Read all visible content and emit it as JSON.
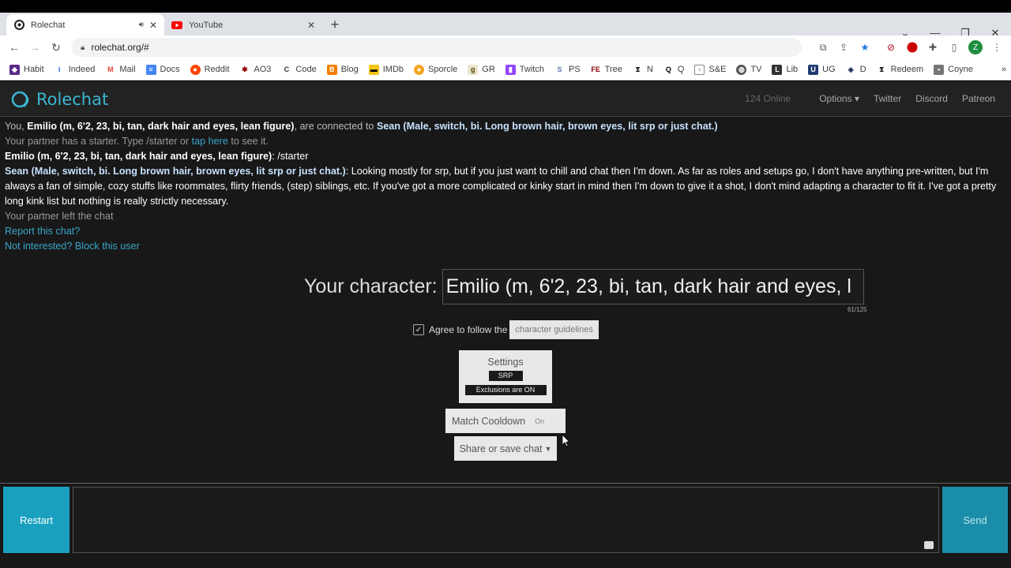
{
  "browser": {
    "tabs": [
      {
        "title": "Rolechat",
        "active": true
      },
      {
        "title": "YouTube",
        "active": false
      }
    ],
    "url": "rolechat.org/#",
    "profile_initial": "Z",
    "bookmarks": [
      "Habit",
      "Indeed",
      "Mail",
      "Docs",
      "Reddit",
      "AO3",
      "Code",
      "Blog",
      "IMDb",
      "Sporcle",
      "GR",
      "Twitch",
      "PS",
      "Tree",
      "N",
      "Q",
      "S&E",
      "TV",
      "Lib",
      "UG",
      "D",
      "Redeem",
      "Coyne"
    ]
  },
  "site": {
    "brand": "Rolechat",
    "online": "124 Online",
    "nav": {
      "options": "Options",
      "twitter": "Twitter",
      "discord": "Discord",
      "patreon": "Patreon"
    },
    "accent": "#3bb7d3"
  },
  "chat": {
    "line1_you": "You, ",
    "line1_me": "Emilio (m, 6'2, 23, bi, tan, dark hair and eyes, lean figure)",
    "line1_mid": ", are connected to ",
    "line1_partner": "Sean (Male, switch, bi. Long brown hair, brown eyes, lit srp or just chat.)",
    "line2_pre": "Your partner has a starter. Type /starter or ",
    "line2_link": "tap here",
    "line2_post": " to see it.",
    "line3_name": "Emilio (m, 6'2, 23, bi, tan, dark hair and eyes, lean figure)",
    "line3_msg": ": /starter",
    "line4_name": "Sean (Male, switch, bi. Long brown hair, brown eyes, lit srp or just chat.)",
    "line4_msg": ": Looking mostly for srp, but if you just want to chill and chat then I'm down. As far as roles and setups go, I don't have anything pre-written, but I'm always a fan of simple, cozy stuffs like roommates, flirty friends, (step) siblings, etc. If you've got a more complicated or kinky start in mind then I'm down to give it a shot, I don't mind adapting a character to fit it. I've got a pretty long kink list but nothing is really strictly necessary.",
    "left": "Your partner left the chat",
    "report": "Report this chat?",
    "block": "Not interested? Block this user"
  },
  "character": {
    "label": "Your character:",
    "value": "Emilio (m, 6'2, 23, bi, tan, dark hair and eyes, l",
    "count": "61/125"
  },
  "agree": {
    "label": "Agree to follow the",
    "button": "character guidelines",
    "checked": true
  },
  "settings": {
    "title": "Settings",
    "mode": "SRP",
    "exclusions": "Exclusions are ON"
  },
  "cooldown": {
    "label": "Match Cooldown",
    "state": "On"
  },
  "share": {
    "label": "Share or save chat"
  },
  "composer": {
    "restart": "Restart",
    "send": "Send",
    "message": ""
  }
}
